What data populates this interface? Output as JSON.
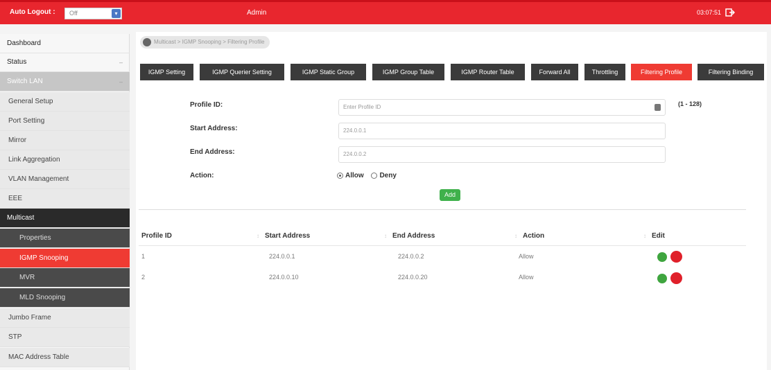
{
  "topbar": {
    "auto_logout_label": "Auto Logout :",
    "auto_logout_value": "Off",
    "user": "Admin",
    "clock": "03:07:51"
  },
  "sidebar": {
    "items": [
      {
        "label": "Dashboard"
      },
      {
        "label": "Status"
      },
      {
        "label": "Switch LAN"
      },
      {
        "label": "General Setup"
      },
      {
        "label": "Port Setting"
      },
      {
        "label": "Mirror"
      },
      {
        "label": "Link Aggregation"
      },
      {
        "label": "VLAN Management"
      },
      {
        "label": "EEE"
      },
      {
        "label": "Multicast"
      },
      {
        "label": "Properties"
      },
      {
        "label": "IGMP Snooping"
      },
      {
        "label": "MVR"
      },
      {
        "label": "MLD Snooping"
      },
      {
        "label": "Jumbo Frame"
      },
      {
        "label": "STP"
      },
      {
        "label": "MAC Address Table"
      }
    ]
  },
  "breadcrumb": "Multicast  > IGMP Snooping  > Filtering Profile",
  "tabs": [
    {
      "label": "IGMP Setting"
    },
    {
      "label": "IGMP Querier Setting"
    },
    {
      "label": "IGMP Static Group"
    },
    {
      "label": "IGMP Group Table"
    },
    {
      "label": "IGMP Router Table"
    },
    {
      "label": "Forward All"
    },
    {
      "label": "Throttling"
    },
    {
      "label": "Filtering Profile"
    },
    {
      "label": "Filtering Binding"
    }
  ],
  "form": {
    "profile_id_label": "Profile ID:",
    "profile_id_placeholder": "Enter Profile ID",
    "profile_id_range": "(1 - 128)",
    "start_address_label": "Start Address:",
    "start_address_value": "224.0.0.1",
    "end_address_label": "End Address:",
    "end_address_value": "224.0.0.2",
    "action_label": "Action:",
    "action_allow": "Allow",
    "action_deny": "Deny",
    "add_button": "Add"
  },
  "table": {
    "headers": [
      "Profile ID",
      "Start Address",
      "End Address",
      "Action",
      "Edit"
    ],
    "rows": [
      [
        "1",
        "224.0.0.1",
        "224.0.0.2",
        "Allow"
      ],
      [
        "2",
        "224.0.0.10",
        "224.0.0.20",
        "Allow"
      ]
    ]
  },
  "colors": {
    "brand": "#e8262e",
    "active_tab": "#ef3b33",
    "add_button": "#3fb14c"
  }
}
